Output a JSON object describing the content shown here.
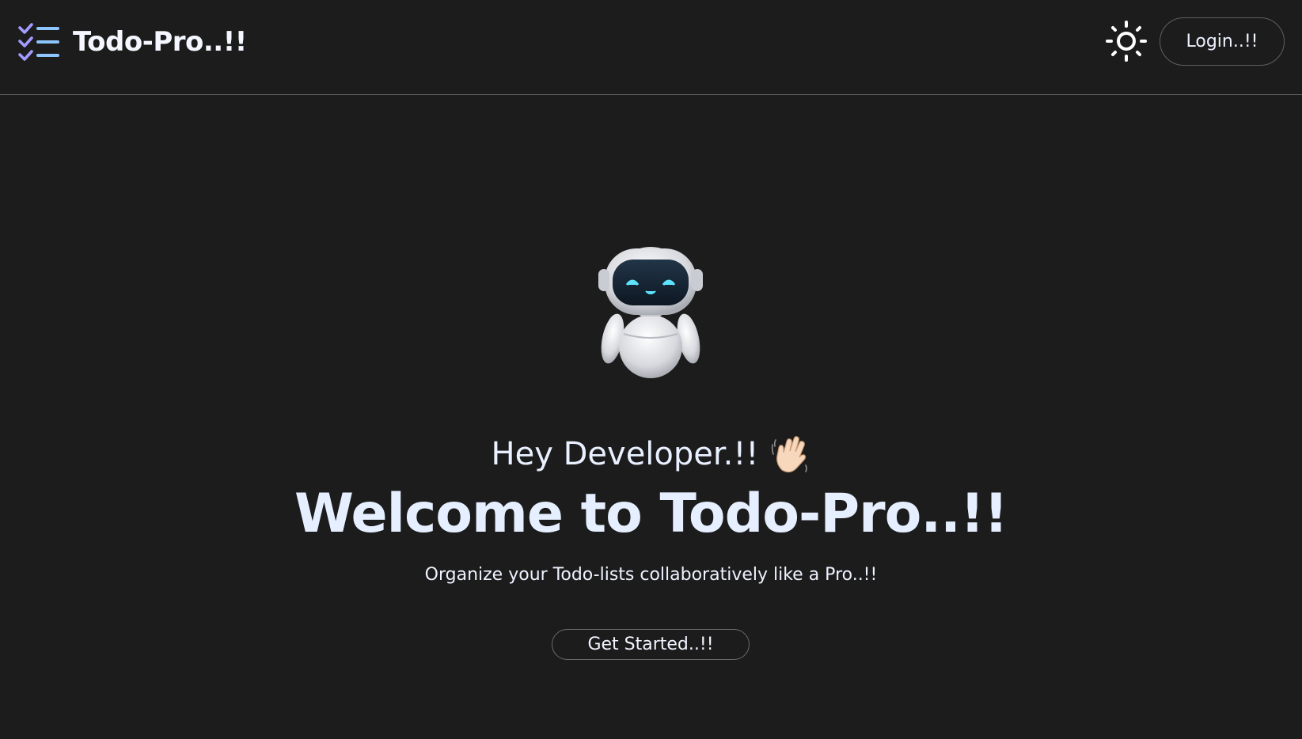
{
  "header": {
    "logo_icon": "checklist-icon",
    "brand": "Todo-Pro..!!",
    "theme_icon": "sun-icon",
    "login_label": "Login..!!"
  },
  "hero": {
    "mascot_icon": "robot-icon",
    "greeting": "Hey Developer.!!",
    "greeting_icon": "waving-hand-icon",
    "headline": "Welcome to Todo-Pro..!!",
    "subtitle": "Organize your Todo-lists collaboratively like a Pro..!!",
    "cta_label": "Get Started..!!"
  },
  "colors": {
    "background": "#1c1c1c",
    "text": "#e9f0ff",
    "border": "#5f5f5f",
    "logo_check": "#a29bfe",
    "logo_lines": "#8ec5ff"
  }
}
